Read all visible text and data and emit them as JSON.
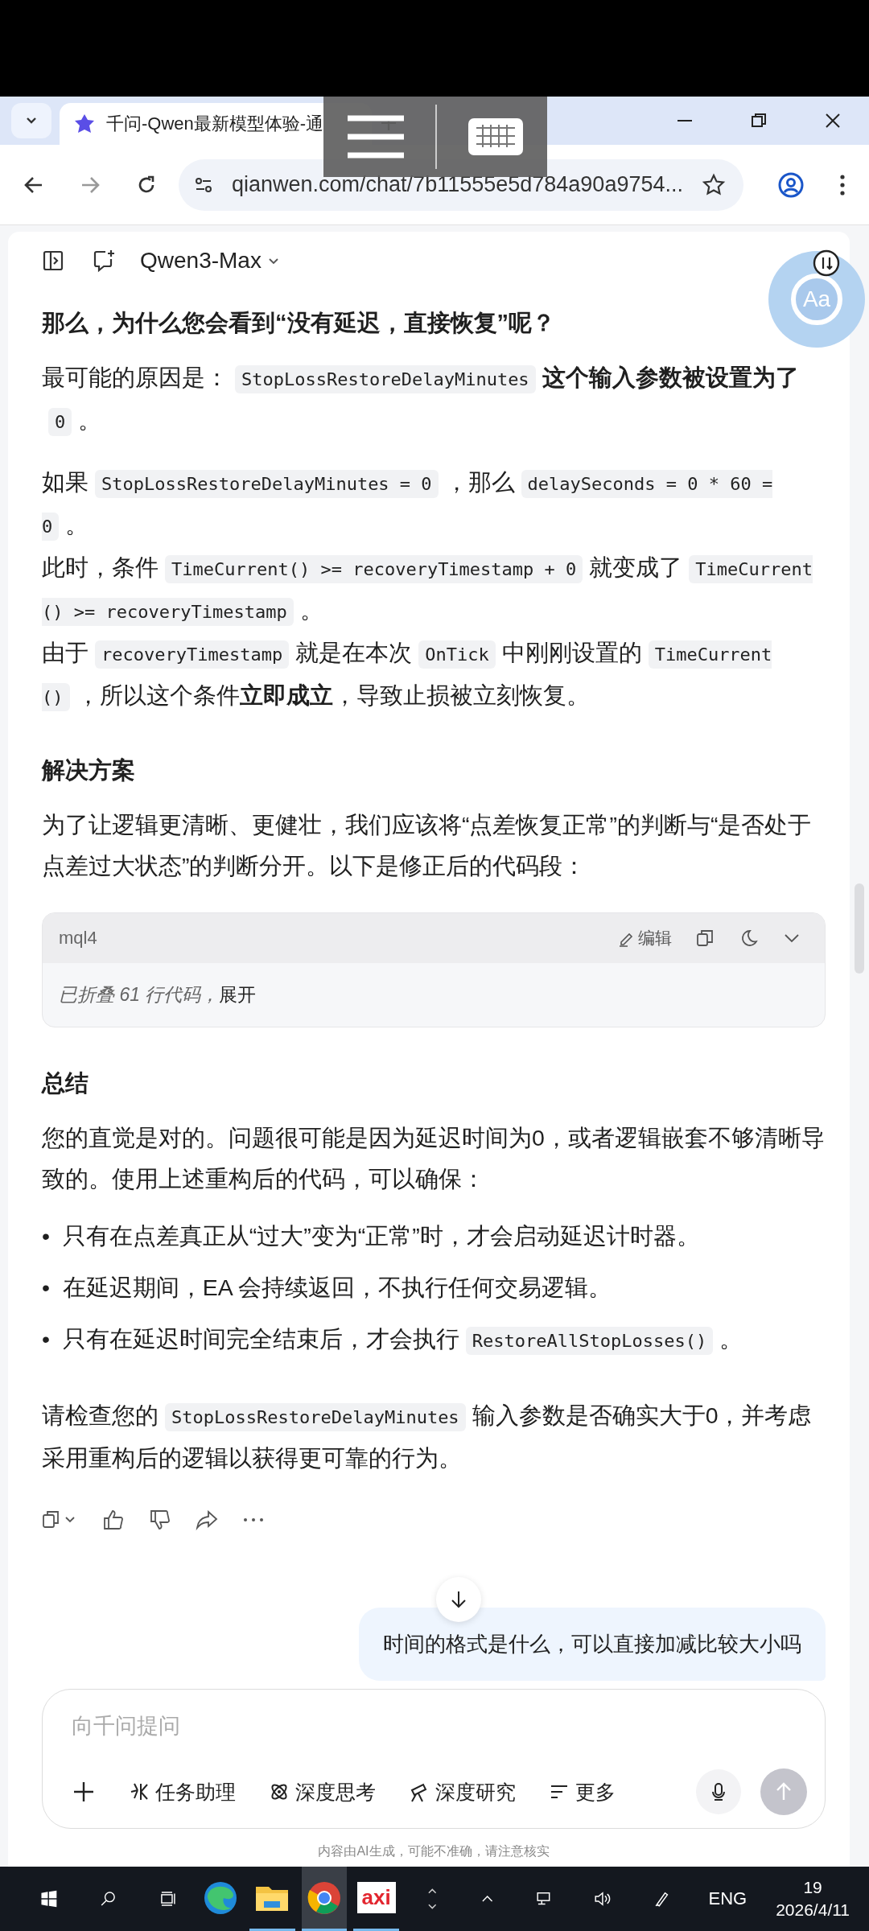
{
  "browser": {
    "tab_title": "千问-Qwen最新模型体验-通",
    "url": "qianwen.com/chat/7b11555e5d784a90a9754..."
  },
  "chat_header": {
    "model": "Qwen3-Max"
  },
  "reading_widget": {
    "label": "Aa"
  },
  "answer": [
    {
      "kind": "heading",
      "text": "那么，为什么您会看到“没有延迟，直接恢复”呢？"
    },
    {
      "kind": "para",
      "lines": [
        [
          {
            "kind": "text",
            "text": "最可能的原因是："
          },
          {
            "kind": "code",
            "text": "StopLossRestoreDelayMinutes"
          },
          {
            "kind": "text",
            "text": "**这个输入参数被设置为了**"
          },
          {
            "kind": "code",
            "text": "0"
          },
          {
            "kind": "text",
            "text": "。"
          }
        ]
      ]
    },
    {
      "kind": "para",
      "lines": [
        [
          {
            "kind": "text",
            "text": "如果"
          },
          {
            "kind": "code",
            "text": "StopLossRestoreDelayMinutes = 0"
          },
          {
            "kind": "text",
            "text": "，那么"
          },
          {
            "kind": "code",
            "text": "delaySeconds = 0 * 60 = 0"
          },
          {
            "kind": "text",
            "text": "。"
          }
        ],
        [
          {
            "kind": "text",
            "text": "此时，条件"
          },
          {
            "kind": "code",
            "text": "TimeCurrent() >= recoveryTimestamp + 0"
          },
          {
            "kind": "text",
            "text": "就变成了"
          },
          {
            "kind": "code",
            "text": "TimeCurrent() >= recoveryTimestamp"
          },
          {
            "kind": "text",
            "text": "。"
          }
        ],
        [
          {
            "kind": "text",
            "text": "由于"
          },
          {
            "kind": "code",
            "text": "recoveryTimestamp"
          },
          {
            "kind": "text",
            "text": "就是在本次"
          },
          {
            "kind": "code",
            "text": "OnTick"
          },
          {
            "kind": "text",
            "text": "中刚刚设置的"
          },
          {
            "kind": "code",
            "text": "TimeCurrent()"
          },
          {
            "kind": "text",
            "text": "，所以这个条件**立即成立**，导致止损被立刻恢复。"
          }
        ]
      ]
    },
    {
      "kind": "heading",
      "text": "解决方案"
    },
    {
      "kind": "para",
      "lines": [
        [
          {
            "kind": "text",
            "text": "为了让逻辑更清晰、更健壮，我们应该将“点差恢复正常”的判断与“是否处于点差过大状态”的判断分开。以下是修正后的代码段："
          }
        ]
      ]
    },
    {
      "kind": "code_block",
      "language": "mql4",
      "edit_label": "编辑",
      "folded_text": "已折叠 61 行代码，",
      "expand_label": "展开"
    },
    {
      "kind": "heading",
      "text": "总结"
    },
    {
      "kind": "para",
      "lines": [
        [
          {
            "kind": "text",
            "text": "您的直觉是对的。问题很可能是因为延迟时间为0，或者逻辑嵌套不够清晰导致的。使用上述重构后的代码，可以确保："
          }
        ]
      ]
    },
    {
      "kind": "bullets",
      "marker": "•",
      "items": [
        [
          {
            "kind": "text",
            "text": "只有在点差真正从“过大”变为“正常”时，才会启动延迟计时器。"
          }
        ],
        [
          {
            "kind": "text",
            "text": "在延迟期间，EA 会持续返回，不执行任何交易逻辑。"
          }
        ],
        [
          {
            "kind": "text",
            "text": "只有在延迟时间完全结束后，才会执行"
          },
          {
            "kind": "code",
            "text": "RestoreAllStopLosses()"
          },
          {
            "kind": "text",
            "text": "。"
          }
        ]
      ]
    },
    {
      "kind": "para",
      "lines": [
        [
          {
            "kind": "text",
            "text": "请检查您的"
          },
          {
            "kind": "code",
            "text": "StopLossRestoreDelayMinutes"
          },
          {
            "kind": "text",
            "text": "输入参数是否确实大于0，并考虑采用重构后的逻辑以获得更可靠的行为。"
          }
        ]
      ]
    }
  ],
  "user_message": "时间的格式是什么，可以直接加减比较大小吗",
  "composer": {
    "placeholder": "向千问提问",
    "tools": [
      {
        "kind": "task",
        "label": "任务助理"
      },
      {
        "kind": "think",
        "label": "深度思考"
      },
      {
        "kind": "research",
        "label": "深度研究"
      },
      {
        "kind": "more",
        "label": "更多"
      }
    ],
    "send_disabled": true
  },
  "disclaimer": "内容由AI生成，可能不准确，请注意核实",
  "taskbar": {
    "apps": [
      {
        "kind": "edge",
        "running": false,
        "selected": false
      },
      {
        "kind": "explorer",
        "running": true,
        "selected": false
      },
      {
        "kind": "chrome",
        "running": true,
        "selected": true
      },
      {
        "kind": "axi",
        "label": "axi",
        "running": true,
        "selected": false
      }
    ],
    "language": "ENG",
    "time": "19",
    "date": "2026/4/11"
  }
}
